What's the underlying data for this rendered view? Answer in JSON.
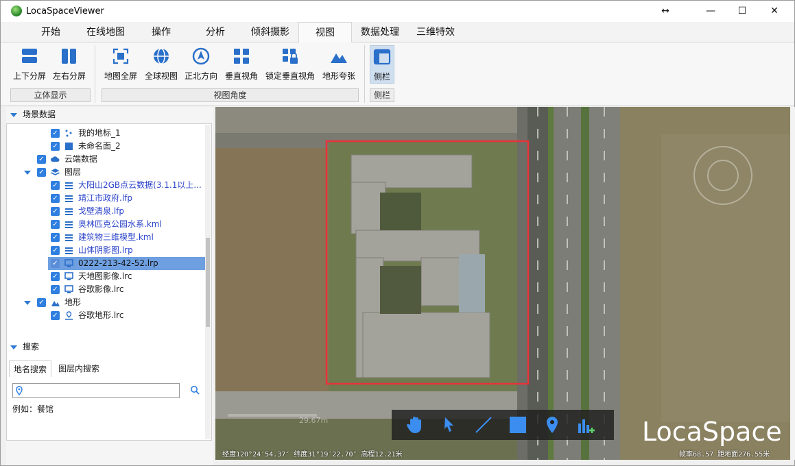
{
  "window": {
    "title": "LocaSpaceViewer",
    "minimize": "—",
    "maximize": "☐",
    "close": "✕",
    "restore": "↔"
  },
  "menu": {
    "tabs": [
      "开始",
      "在线地图",
      "操作",
      "分析",
      "倾斜摄影",
      "视图",
      "数据处理",
      "三维特效"
    ],
    "active": "视图"
  },
  "ribbon": {
    "buttons": [
      {
        "label": "上下分屏",
        "icon": "split-horizontal-icon"
      },
      {
        "label": "左右分屏",
        "icon": "split-vertical-icon"
      },
      {
        "label": "地图全屏",
        "icon": "fullscreen-icon"
      },
      {
        "label": "全球视图",
        "icon": "globe-icon"
      },
      {
        "label": "正北方向",
        "icon": "north-arrow-icon"
      },
      {
        "label": "垂直视角",
        "icon": "grid-view-icon"
      },
      {
        "label": "锁定垂直视角",
        "icon": "lock-view-icon"
      },
      {
        "label": "地形夸张",
        "icon": "terrain-icon"
      },
      {
        "label": "侧栏",
        "icon": "sidebar-icon"
      }
    ],
    "groups": [
      "立体显示",
      "视图角度",
      "侧栏"
    ]
  },
  "scene": {
    "header": "场景数据",
    "items": [
      {
        "label": "我的地标_1",
        "icon": "placemark-icon",
        "link": false
      },
      {
        "label": "未命名面_2",
        "icon": "polygon-icon",
        "link": false
      },
      {
        "label": "云端数据",
        "icon": "cloud-icon",
        "link": false
      },
      {
        "label": "图层",
        "icon": "layers-icon",
        "link": false
      },
      {
        "label": "大阳山2GB点云数据(3.1.1以上...",
        "icon": "layer-list-icon",
        "link": true
      },
      {
        "label": "靖江市政府.lfp",
        "icon": "layer-list-icon",
        "link": true
      },
      {
        "label": "戈壁清泉.lfp",
        "icon": "layer-list-icon",
        "link": true
      },
      {
        "label": "奥林匹克公园水系.kml",
        "icon": "layer-list-icon",
        "link": true
      },
      {
        "label": "建筑物三维模型.kml",
        "icon": "layer-list-icon",
        "link": true
      },
      {
        "label": "山体阴影图.lrp",
        "icon": "layer-list-icon",
        "link": true
      },
      {
        "label": "0222-213-42-52.lrp",
        "icon": "monitor-icon",
        "link": false
      },
      {
        "label": "天地图影像.lrc",
        "icon": "monitor-icon",
        "link": false
      },
      {
        "label": "谷歌影像.lrc",
        "icon": "monitor-icon",
        "link": false
      },
      {
        "label": "地形",
        "icon": "terrain-small-icon",
        "link": false
      },
      {
        "label": "谷歌地形.lrc",
        "icon": "terrain-pin-icon",
        "link": false
      }
    ]
  },
  "search": {
    "header": "搜索",
    "tabs": [
      "地名搜索",
      "图层内搜索"
    ],
    "placeholder": "",
    "hint": "例如：餐馆"
  },
  "map": {
    "brand": "LocaSpace",
    "scale_text": "29.67m",
    "status_left": "经度120°24′54.37″ 纬度31°19′22.70″ 高程12.21米",
    "status_right": "帧率68.57 距地面276.55米",
    "tools": [
      "hand-icon",
      "pointer-icon",
      "line-icon",
      "polygon-tool-icon",
      "pin-icon",
      "chart-add-icon"
    ]
  },
  "colors": {
    "accent": "#2f7fe0",
    "selection": "#6e9fe0",
    "highlight_box": "#e8323a"
  }
}
